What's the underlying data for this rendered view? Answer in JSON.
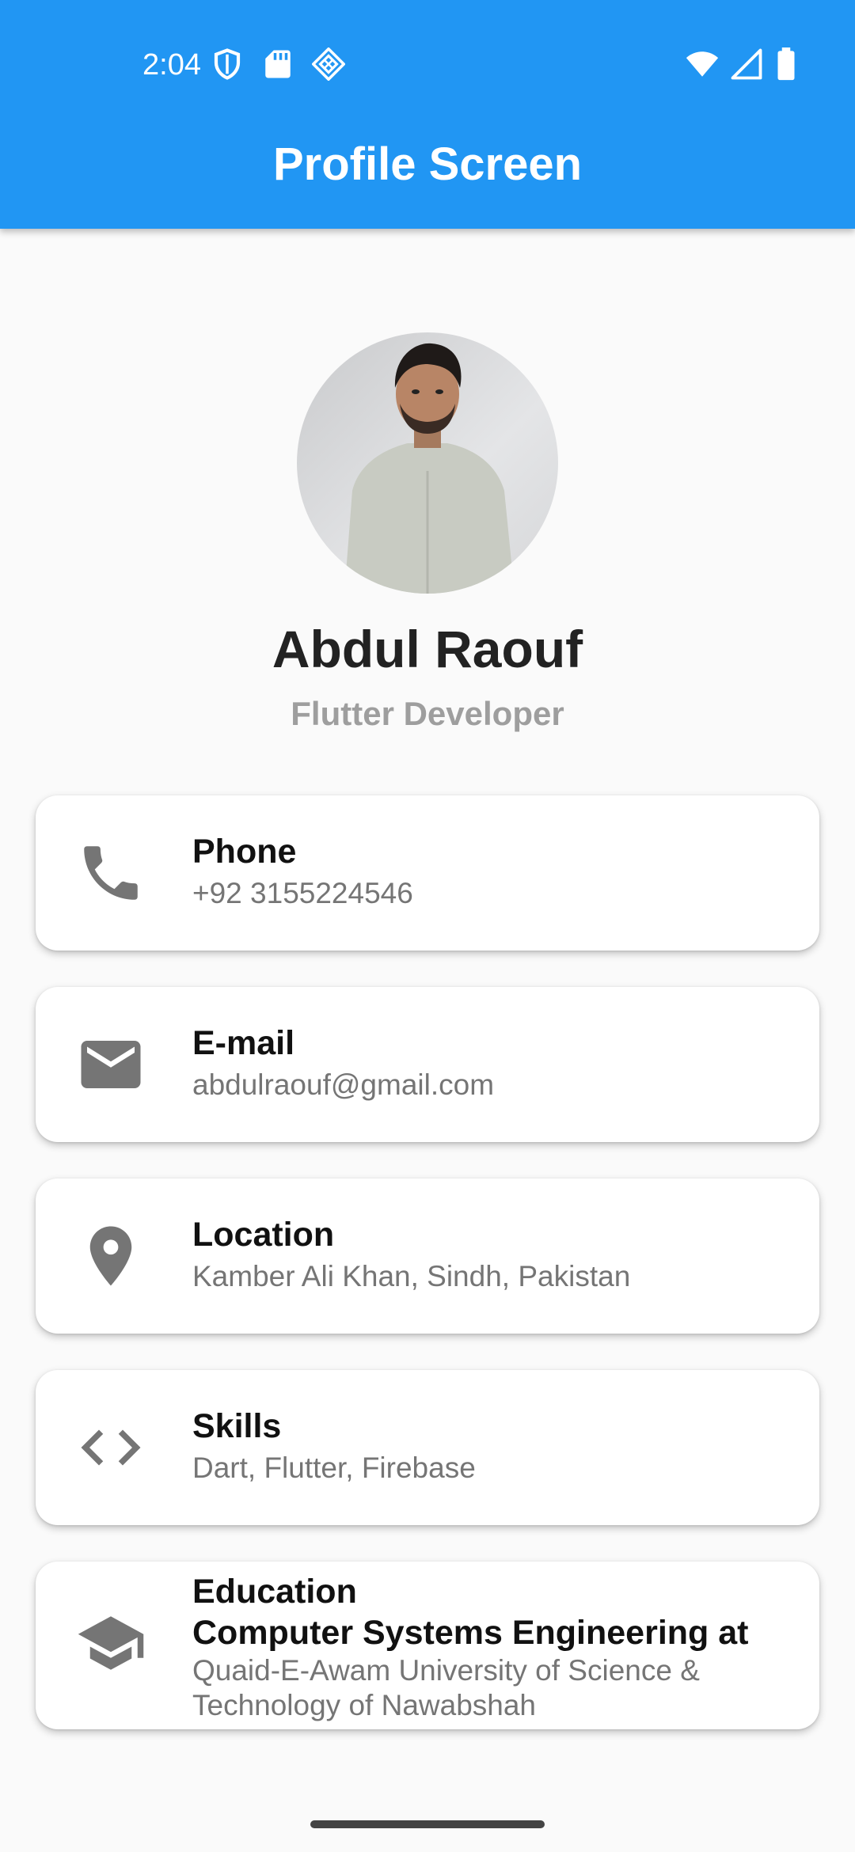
{
  "status_bar": {
    "time": "2:04",
    "left_icons": [
      "shield-icon",
      "sd-card-icon",
      "diamond-grid-icon"
    ],
    "right_icons": [
      "wifi-icon",
      "signal-icon",
      "battery-icon"
    ]
  },
  "app_bar": {
    "title": "Profile Screen",
    "color": "#2196f3"
  },
  "profile": {
    "name": "Abdul Raouf",
    "role": "Flutter Developer"
  },
  "cards": {
    "phone": {
      "title": "Phone",
      "value": "+92 3155224546",
      "icon": "phone-icon"
    },
    "email": {
      "title": "E-mail",
      "value": "abdulraouf@gmail.com",
      "icon": "mail-icon"
    },
    "location": {
      "title": "Location",
      "value": "Kamber Ali Khan, Sindh, Pakistan",
      "icon": "location-pin-icon"
    },
    "skills": {
      "title": "Skills",
      "value": "Dart, Flutter, Firebase",
      "icon": "code-icon"
    },
    "education": {
      "title": "Education",
      "degree": "Computer Systems Engineering at",
      "institution": "Quaid-E-Awam University of Science & Technology of Nawabshah",
      "icon": "graduation-cap-icon"
    }
  }
}
